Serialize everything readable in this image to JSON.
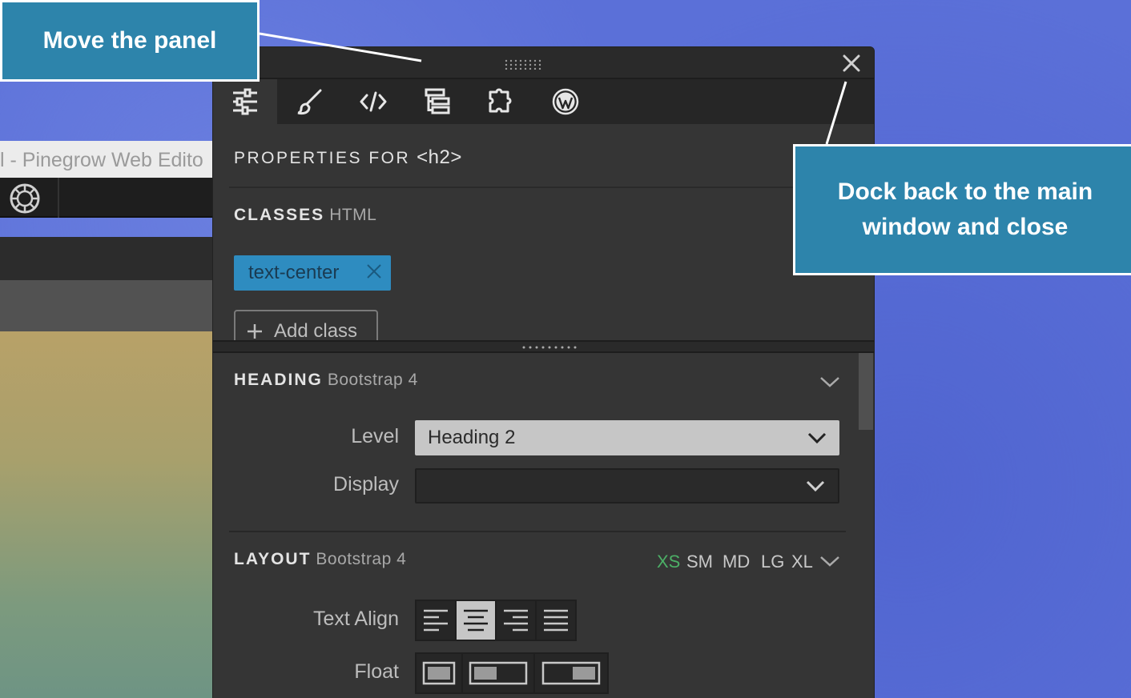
{
  "background_window": {
    "title_fragment": "l - Pinegrow Web Edito"
  },
  "annotations": {
    "move": "Move the panel",
    "dock": "Dock back to the main window and close"
  },
  "panel": {
    "tabs": [
      {
        "icon": "sliders-icon",
        "active": true
      },
      {
        "icon": "brush-icon",
        "active": false
      },
      {
        "icon": "code-icon",
        "active": false
      },
      {
        "icon": "tree-icon",
        "active": false
      },
      {
        "icon": "puzzle-icon",
        "active": false
      },
      {
        "icon": "wordpress-icon",
        "active": false
      }
    ],
    "properties": {
      "label": "PROPERTIES FOR",
      "tag": "<h2>"
    },
    "classes": {
      "title": "CLASSES",
      "subtitle": "HTML",
      "items": [
        "text-center"
      ],
      "add_label": "Add class"
    },
    "heading": {
      "title": "HEADING",
      "framework": "Bootstrap 4",
      "level_label": "Level",
      "level_value": "Heading 2",
      "display_label": "Display",
      "display_value": ""
    },
    "layout": {
      "title": "LAYOUT",
      "framework": "Bootstrap 4",
      "breakpoints": [
        "XS",
        "SM",
        "MD",
        "LG",
        "XL"
      ],
      "active_breakpoint": "XS",
      "text_align_label": "Text Align",
      "text_align_selected": "center",
      "float_label": "Float"
    }
  },
  "colors": {
    "accent": "#2d84ab",
    "chip": "#2e8cc0",
    "breakpoint_active": "#4caf66",
    "panel_bg": "#353535"
  }
}
